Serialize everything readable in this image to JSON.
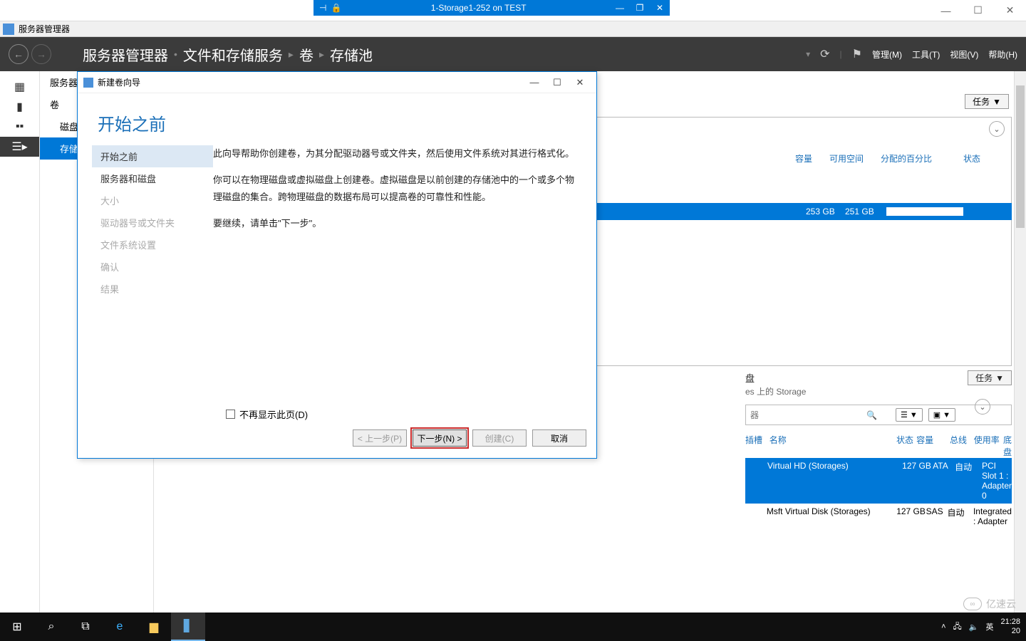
{
  "outer_window": {
    "min": "—",
    "max": "☐",
    "close": "✕"
  },
  "rdp": {
    "title": "1-Storage1-252 on TEST"
  },
  "app": {
    "title": "服务器管理器"
  },
  "header": {
    "breadcrumb": [
      "服务器管理器",
      "文件和存储服务",
      "卷",
      "存储池"
    ],
    "menus": {
      "manage": "管理(M)",
      "tools": "工具(T)",
      "view": "视图(V)",
      "help": "帮助(H)"
    }
  },
  "nav": {
    "items": [
      "服务器",
      "卷",
      "磁盘",
      "存储"
    ],
    "selected_index": 3
  },
  "pool": {
    "section_label": "存储池",
    "tasks": "任务",
    "headers": {
      "capacity": "容量",
      "free": "可用空间",
      "alloc": "分配的百分比",
      "status": "状态"
    },
    "row": {
      "capacity": "253 GB",
      "free": "251 GB"
    }
  },
  "disks": {
    "section_suffix_a": "盘",
    "subtitle_suffix": "es 上的 Storage",
    "tasks": "任务",
    "filter_placeholder": "器",
    "headers": {
      "slot": "插槽",
      "name": "名称",
      "status": "状态",
      "capacity": "容量",
      "bus": "总线",
      "usage": "使用率",
      "chassis": "底盘"
    },
    "rows": [
      {
        "slot": "",
        "name": "Virtual HD (Storages)",
        "status": "",
        "capacity": "127 GB",
        "bus": "ATA",
        "usage": "自动",
        "chassis": "PCI Slot 1 : Adapter 0"
      },
      {
        "slot": "",
        "name": "Msft Virtual Disk (Storages)",
        "status": "",
        "capacity": "127 GB",
        "bus": "SAS",
        "usage": "自动",
        "chassis": "Integrated : Adapter"
      }
    ]
  },
  "wizard": {
    "title": "新建卷向导",
    "heading": "开始之前",
    "steps": [
      "开始之前",
      "服务器和磁盘",
      "大小",
      "驱动器号或文件夹",
      "文件系统设置",
      "确认",
      "结果"
    ],
    "para1": "此向导帮助你创建卷，为其分配驱动器号或文件夹，然后使用文件系统对其进行格式化。",
    "para2": "你可以在物理磁盘或虚拟磁盘上创建卷。虚拟磁盘是以前创建的存储池中的一个或多个物理磁盘的集合。跨物理磁盘的数据布局可以提高卷的可靠性和性能。",
    "para3": "要继续，请单击\"下一步\"。",
    "checkbox": "不再显示此页(D)",
    "buttons": {
      "prev": "< 上一步(P)",
      "next": "下一步(N) >",
      "create": "创建(C)",
      "cancel": "取消"
    }
  },
  "watermark": "亿速云",
  "taskbar": {
    "tray": {
      "ime": "英",
      "time": "21:28",
      "date": "20"
    }
  }
}
